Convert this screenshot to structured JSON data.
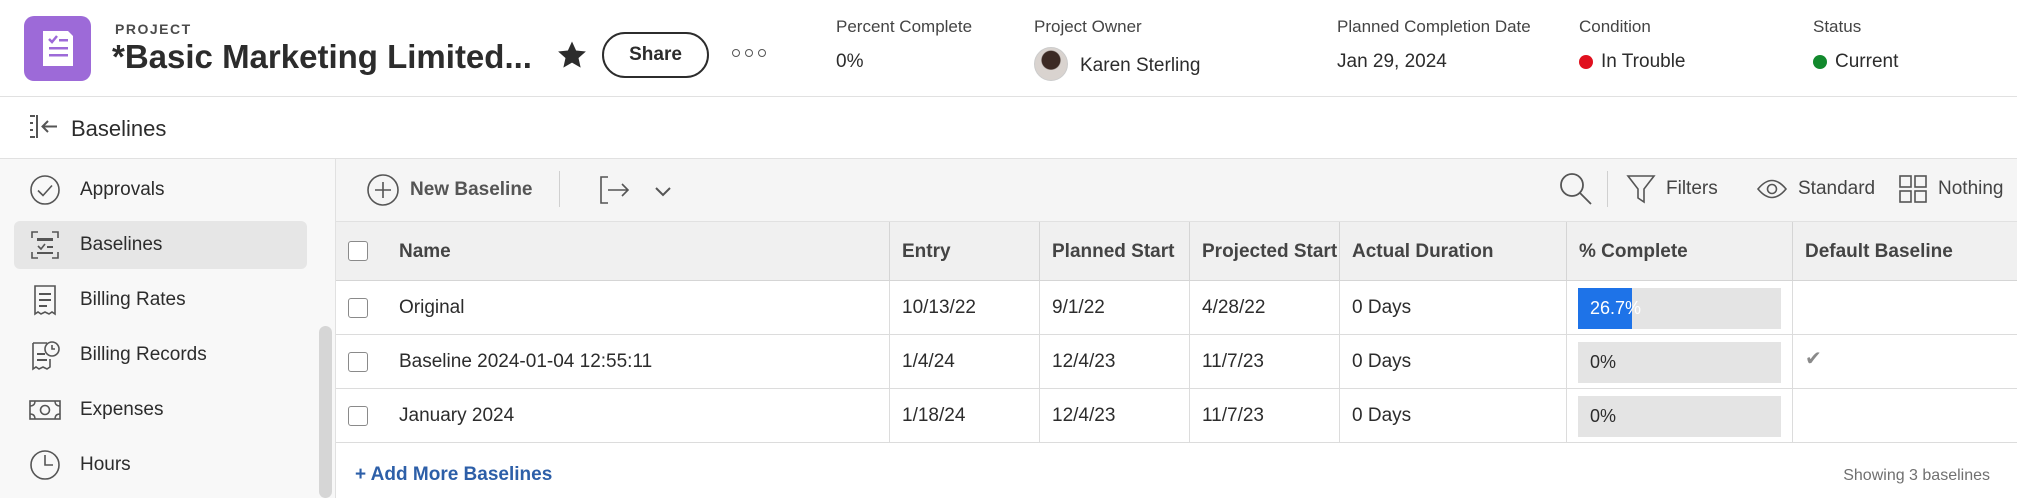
{
  "header": {
    "project_label": "PROJECT",
    "project_title": "*Basic Marketing Limited...",
    "share_label": "Share",
    "percent_complete": {
      "label": "Percent Complete",
      "value": "0%"
    },
    "project_owner": {
      "label": "Project Owner",
      "value": "Karen Sterling"
    },
    "planned_completion": {
      "label": "Planned Completion Date",
      "value": "Jan 29, 2024"
    },
    "condition": {
      "label": "Condition",
      "value": "In Trouble",
      "color": "#e0101e"
    },
    "status": {
      "label": "Status",
      "value": "Current",
      "color": "#12892d"
    },
    "accent_color": "#9d6ad8"
  },
  "breadcrumb": {
    "title": "Baselines"
  },
  "sidebar": {
    "items": [
      {
        "label": "Approvals",
        "icon": "approval-check-icon",
        "active": false
      },
      {
        "label": "Baselines",
        "icon": "baseline-icon",
        "active": true
      },
      {
        "label": "Billing Rates",
        "icon": "billing-rates-icon",
        "active": false
      },
      {
        "label": "Billing Records",
        "icon": "billing-records-icon",
        "active": false
      },
      {
        "label": "Expenses",
        "icon": "money-icon",
        "active": false
      },
      {
        "label": "Hours",
        "icon": "clock-icon",
        "active": false
      }
    ]
  },
  "toolbar": {
    "new_label": "New Baseline",
    "filters_label": "Filters",
    "view_label": "Standard",
    "group_label": "Nothing"
  },
  "table": {
    "columns": [
      "Name",
      "Entry",
      "Planned Start",
      "Projected Start",
      "Actual Duration",
      "% Complete",
      "Default Baseline"
    ],
    "rows": [
      {
        "name": "Original",
        "entry": "10/13/22",
        "planned_start": "9/1/22",
        "projected_start": "4/28/22",
        "duration": "0 Days",
        "complete_pct": 26.7,
        "complete_label": "26.7%",
        "default_mark": ""
      },
      {
        "name": "Baseline 2024-01-04 12:55:11",
        "entry": "1/4/24",
        "planned_start": "12/4/23",
        "projected_start": "11/7/23",
        "duration": "0 Days",
        "complete_pct": 0,
        "complete_label": "0%",
        "default_mark": "✔"
      },
      {
        "name": "January 2024",
        "entry": "1/18/24",
        "planned_start": "12/4/23",
        "projected_start": "11/7/23",
        "duration": "0 Days",
        "complete_pct": 0,
        "complete_label": "0%",
        "default_mark": ""
      }
    ],
    "progress_color": "#1e73e8"
  },
  "footer": {
    "add_more_label": "+ Add More Baselines",
    "showing_label": "Showing 3 baselines"
  }
}
